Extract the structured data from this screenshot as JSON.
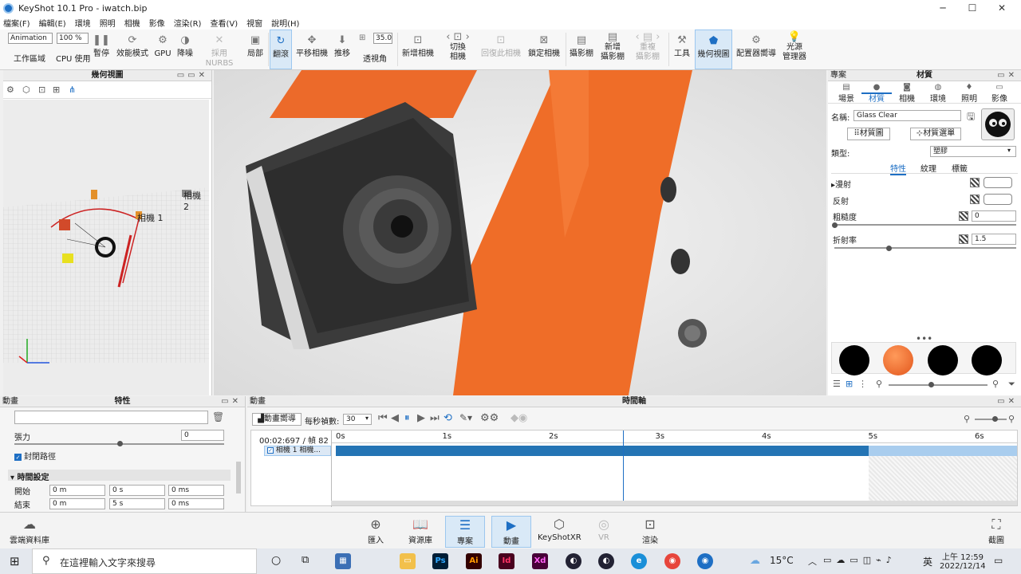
{
  "window": {
    "title": "KeyShot 10.1 Pro  -  iwatch.bip",
    "minimize": "─",
    "maximize": "☐",
    "close": "✕"
  },
  "menu": [
    "檔案(F)",
    "編輯(E)",
    "環境",
    "照明",
    "相機",
    "影像",
    "渲染(R)",
    "查看(V)",
    "視窗",
    "說明(H)"
  ],
  "toolbar": {
    "workspace_select": "Animation",
    "workspace_label": "工作區域",
    "cpu_select": "100 %",
    "cpu_label": "CPU 使用",
    "pause_label": "暫停",
    "perf_label": "效能模式",
    "gpu_label": "GPU",
    "denoise_label": "降噪",
    "nurbs_label": "採用NURBS",
    "region_label": "局部",
    "tumble_label": "翻滾",
    "pan_label": "平移相機",
    "dolly_label": "推移",
    "fov_value": "35.0",
    "fov_label": "透視角",
    "new_camera_label": "新增相機",
    "switch_camera_label": "切換\n相機",
    "reset_camera_label": "回復此相機",
    "lock_camera_label": "鎖定相機",
    "studio_label": "攝影棚",
    "new_studio_label": "新增\n攝影棚",
    "reset_studio_label": "重複\n攝影棚",
    "tools_label": "工具",
    "geometry_view_label": "幾何視圖",
    "configurator_label": "配置器嚮導",
    "light_manager_label": "光源\n管理器"
  },
  "geometry_panel": {
    "title": "幾何視圖",
    "camera1": "相機 1",
    "camera2": "相機 2"
  },
  "right_panel": {
    "left_title": "專案",
    "title": "材質",
    "tabs": [
      {
        "label": "場景",
        "icon": "scene-icon"
      },
      {
        "label": "材質",
        "icon": "material-icon"
      },
      {
        "label": "相機",
        "icon": "camera-icon"
      },
      {
        "label": "環境",
        "icon": "environment-icon"
      },
      {
        "label": "照明",
        "icon": "lighting-icon"
      },
      {
        "label": "影像",
        "icon": "image-icon"
      }
    ],
    "name_label": "名稱:",
    "name_value": "Glass Clear",
    "material_graph_btn": "材質圖",
    "material_picker_btn": "材質選單",
    "type_label": "類型:",
    "type_value": "塑膠",
    "subtabs": [
      "特性",
      "紋理",
      "標籤"
    ],
    "diffuse_label": "漫射",
    "specular_label": "反射",
    "roughness_label": "粗糙度",
    "roughness_value": "0",
    "roughness_level": 0.0,
    "ior_label": "折射率",
    "ior_value": "1.5",
    "ior_level": 0.3
  },
  "props_panel": {
    "left_title": "動畫",
    "title": "特性",
    "tension_label": "張力",
    "tension_value": "0",
    "tension_level": 0.5,
    "closed_path_label": "封閉路徑",
    "timing_header": "時間設定",
    "start_label": "開始",
    "end_label": "結束",
    "start_values": [
      "0 m",
      "0 s",
      "0 ms"
    ],
    "end_values": [
      "0 m",
      "5 s",
      "0 ms"
    ]
  },
  "timeline": {
    "left_title": "動畫",
    "title": "時間軸",
    "wizard_btn": "動畫嚮導",
    "fps_label": "每秒禎數:",
    "fps_value": "30",
    "timecode": "00:02:697 / 幀 82",
    "ticks": [
      "0s",
      "1s",
      "2s",
      "3s",
      "4s",
      "5s",
      "6s"
    ],
    "track_label": "相機 1 相機...",
    "playhead_seconds": 2.697,
    "track_end_seconds": 5
  },
  "bottombar": {
    "cloud_library": "雲端資料庫",
    "import": "匯入",
    "library": "資源庫",
    "project": "專案",
    "animation": "動畫",
    "keyshotxr": "KeyShotXR",
    "vr": "VR",
    "render": "渲染",
    "screenshot": "截圖"
  },
  "taskbar": {
    "search_placeholder": "在這裡輸入文字來搜尋",
    "weather": "15°C",
    "ime": "英",
    "time": "上午 12:59",
    "date": "2022/12/14"
  }
}
